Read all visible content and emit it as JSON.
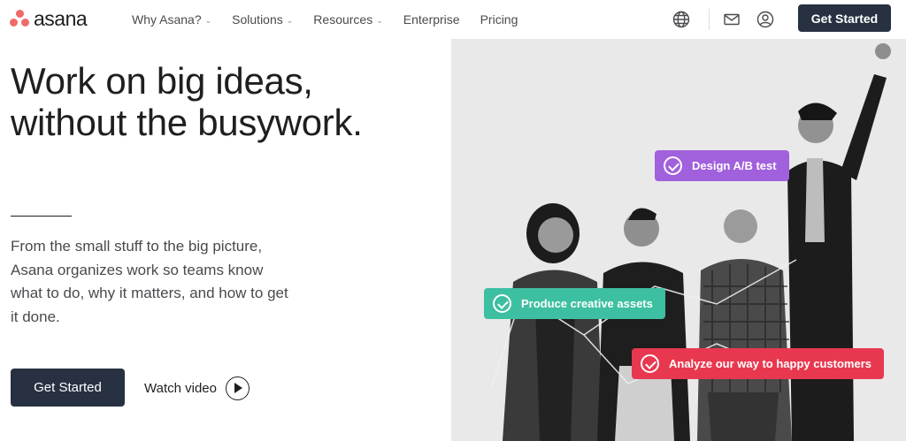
{
  "brand": {
    "name": "asana",
    "logo_color": "#f06a6a"
  },
  "nav": {
    "items": [
      {
        "label": "Why Asana?",
        "has_dropdown": true
      },
      {
        "label": "Solutions",
        "has_dropdown": true
      },
      {
        "label": "Resources",
        "has_dropdown": true
      },
      {
        "label": "Enterprise",
        "has_dropdown": false
      },
      {
        "label": "Pricing",
        "has_dropdown": false
      }
    ],
    "dropdown_icon": "chevron-down-icon",
    "icons": [
      "globe-icon",
      "mail-icon",
      "user-icon"
    ],
    "cta_label": "Get Started"
  },
  "hero": {
    "title_line1": "Work on big ideas,",
    "title_line2": "without the busywork.",
    "subtitle": "From the small stuff to the big picture, Asana organizes work so teams know what to do, why it matters, and how to get it done.",
    "cta_label": "Get Started",
    "watch_label": "Watch video",
    "watch_icon": "play-icon"
  },
  "tasks": [
    {
      "label": "Design A/B test",
      "color": "#a160dc"
    },
    {
      "label": "Produce creative assets",
      "color": "#3dbfa2"
    },
    {
      "label": "Analyze our way to happy customers",
      "color": "#e8384f"
    }
  ],
  "colors": {
    "accent_dark": "#273142",
    "text": "#1e1f21",
    "muted": "#494a4e"
  }
}
